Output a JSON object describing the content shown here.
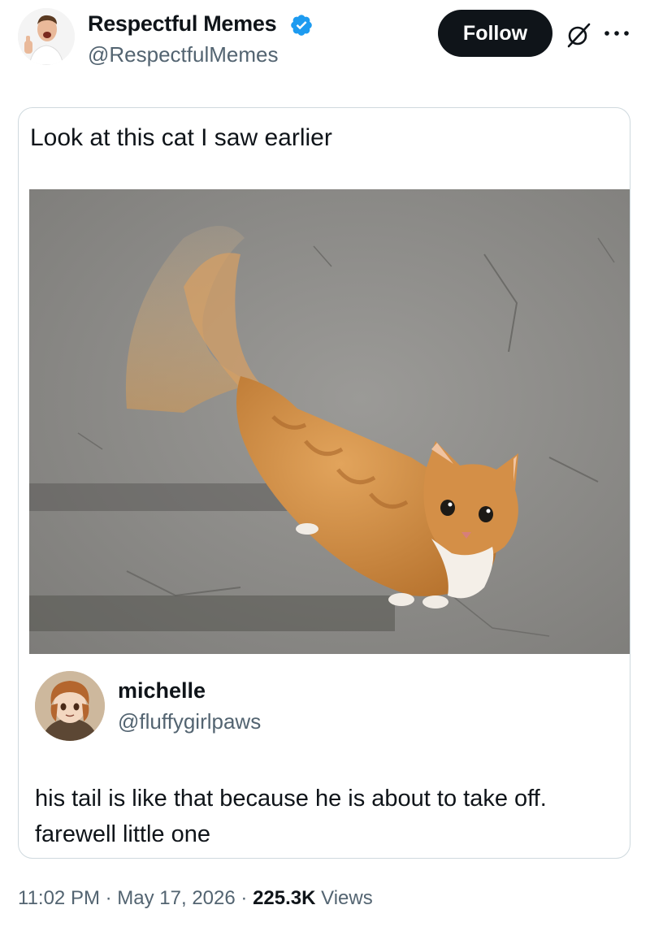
{
  "account": {
    "display_name": "Respectful Memes",
    "handle": "@RespectfulMemes",
    "verified": true
  },
  "actions": {
    "follow_label": "Follow",
    "grok_icon": "grok-slash-icon",
    "more_icon": "more-dots-icon"
  },
  "post": {
    "text": "Look at this cat I saw earlier"
  },
  "reply": {
    "name": "michelle",
    "handle": "@fluffygirlpaws",
    "line1": "his tail is like that because he is about to take off.",
    "line2": "farewell little one"
  },
  "meta": {
    "time": "11:02 PM",
    "sep1": "·",
    "date": "May 17, 2026",
    "sep2": "·",
    "views_count": "225.3K",
    "views_label": "Views"
  },
  "colors": {
    "text": "#0f1419",
    "secondary": "#536471",
    "verified_blue": "#1d9bf0",
    "border": "#cfd9de"
  }
}
